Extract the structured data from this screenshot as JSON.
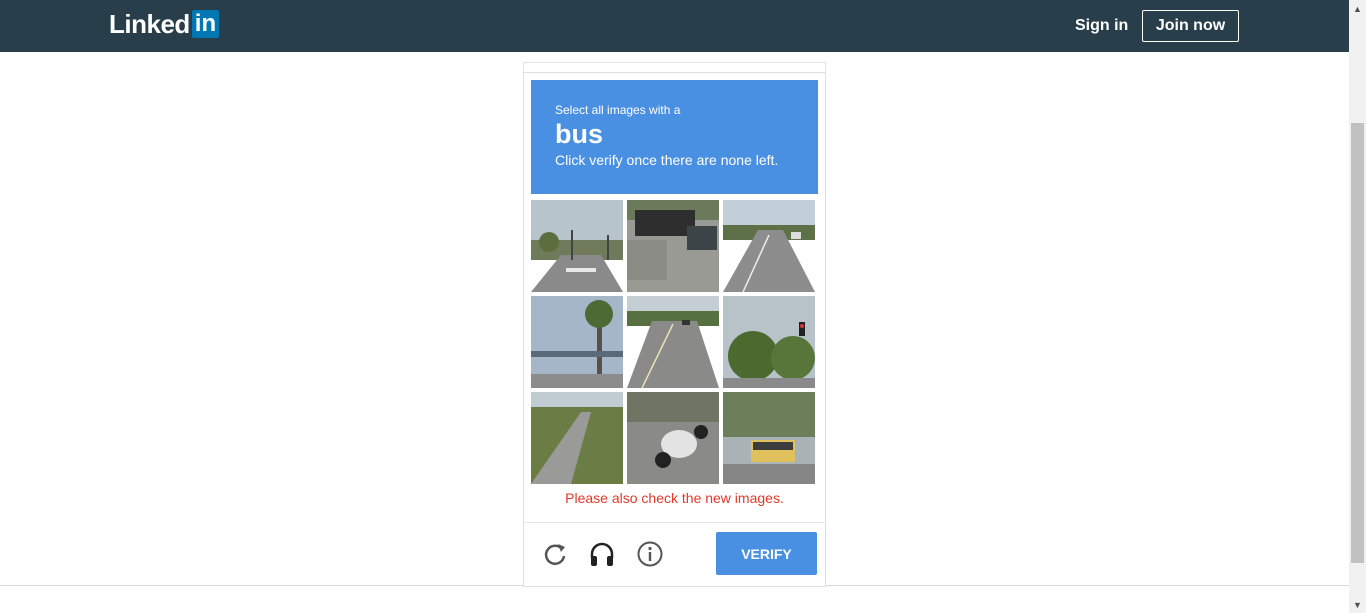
{
  "header": {
    "logo_text": "Linked",
    "logo_box": "in",
    "signin_label": "Sign in",
    "join_label": "Join now",
    "background": "#283e4a"
  },
  "captcha": {
    "prompt_line1": "Select all images with a",
    "prompt_target": "bus",
    "prompt_line3": "Click verify once there are none left.",
    "prompt_color": "#4a90e2",
    "message": "Please also check the new images.",
    "message_color": "#e0392b",
    "verify_label": "VERIFY",
    "icons": [
      "reload-icon",
      "headphones-icon",
      "info-icon"
    ],
    "tiles": [
      "street-intersection",
      "truck-and-car-on-highway",
      "road-with-cars",
      "palm-tree-and-bridge",
      "highway-traffic",
      "traffic-light-and-trees",
      "road-with-grass-median",
      "motorcycle",
      "bus-on-street"
    ]
  }
}
